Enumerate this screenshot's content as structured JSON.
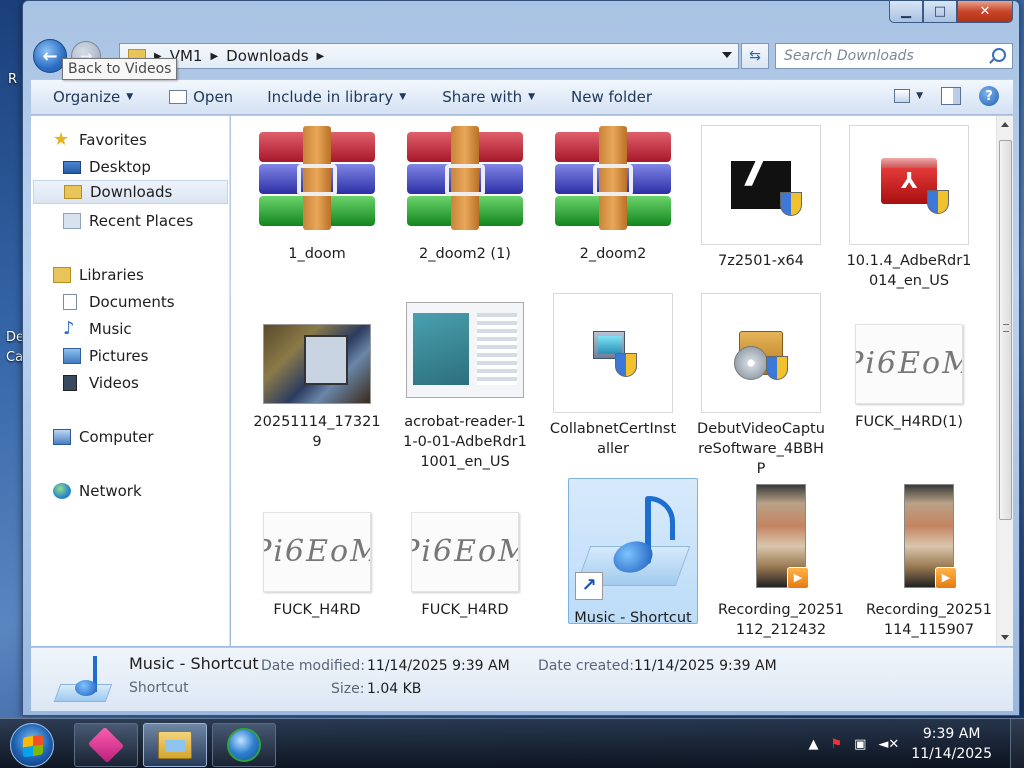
{
  "window": {
    "caption": {
      "minimize": "▁",
      "maximize": "□",
      "close": "✕"
    }
  },
  "address": {
    "crumbs": [
      "VM1",
      "Downloads"
    ],
    "search_placeholder": "Search Downloads",
    "back_tooltip": "Back to Videos"
  },
  "toolbar": {
    "organize": "Organize",
    "open": "Open",
    "include_in_library": "Include in library",
    "share_with": "Share with",
    "new_folder": "New folder",
    "help": "?"
  },
  "sidebar": {
    "favorites": "Favorites",
    "desktop": "Desktop",
    "downloads": "Downloads",
    "recent_places": "Recent Places",
    "libraries": "Libraries",
    "documents": "Documents",
    "music": "Music",
    "pictures": "Pictures",
    "videos": "Videos",
    "computer": "Computer",
    "network": "Network"
  },
  "files": [
    {
      "name": "1_doom",
      "icon": "winrar-archive-icon"
    },
    {
      "name": "2_doom2 (1)",
      "icon": "winrar-archive-icon"
    },
    {
      "name": "2_doom2",
      "icon": "winrar-archive-icon"
    },
    {
      "name": "7z2501-x64",
      "icon": "7zip-installer-icon"
    },
    {
      "name": "10.1.4_AdbeRdr1014_en_US",
      "icon": "adobe-installer-icon"
    },
    {
      "name": "20251114_173219",
      "icon": "photo-thumbnail-icon"
    },
    {
      "name": "acrobat-reader-11-0-01-AdbeRdr11001_en_US",
      "icon": "screenshot-thumbnail-icon"
    },
    {
      "name": "CollabnetCertInstaller",
      "icon": "installer-icon"
    },
    {
      "name": "DebutVideoCaptureSoftware_4BBHP",
      "icon": "debut-installer-icon"
    },
    {
      "name": "FUCK_H4RD(1)",
      "icon": "handwriting-thumbnail-icon"
    },
    {
      "name": "FUCK_H4RD",
      "icon": "handwriting-thumbnail-icon"
    },
    {
      "name": "FUCK_H4RD",
      "icon": "handwriting-thumbnail-icon"
    },
    {
      "name": "Music - Shortcut",
      "icon": "music-shortcut-icon"
    },
    {
      "name": "Recording_20251112_212432",
      "icon": "video-thumbnail-icon"
    },
    {
      "name": "Recording_20251114_115907",
      "icon": "video-thumbnail-icon"
    }
  ],
  "handwriting_text": "Pi6EoM",
  "details": {
    "name": "Music - Shortcut",
    "type": "Shortcut",
    "date_modified_label": "Date modified:",
    "date_modified": "11/14/2025 9:39 AM",
    "date_created_label": "Date created:",
    "date_created": "11/14/2025 9:39 AM",
    "size_label": "Size:",
    "size": "1.04 KB"
  },
  "taskbar": {
    "time": "9:39 AM",
    "date": "11/14/2025"
  },
  "colors": {
    "selection": "#cce4f7",
    "accent": "#1c6fd0"
  }
}
